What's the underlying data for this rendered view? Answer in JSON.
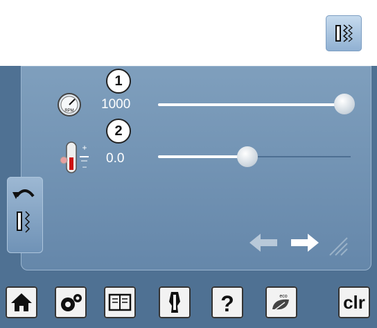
{
  "markers": {
    "one": "1",
    "two": "2"
  },
  "speed": {
    "value": "1000",
    "level": 1.0
  },
  "tension": {
    "value": "0.0",
    "level": 0.5
  },
  "toolbar": {
    "clr_label": "clr"
  },
  "icons": [
    "stitch-pattern-icon",
    "speedometer-icon",
    "thread-tension-icon",
    "back-stitch-tab-icon",
    "arrow-left-icon",
    "arrow-right-icon",
    "home-icon",
    "settings-icon",
    "tutorial-icon",
    "sewing-guide-icon",
    "help-icon",
    "eco-icon"
  ]
}
